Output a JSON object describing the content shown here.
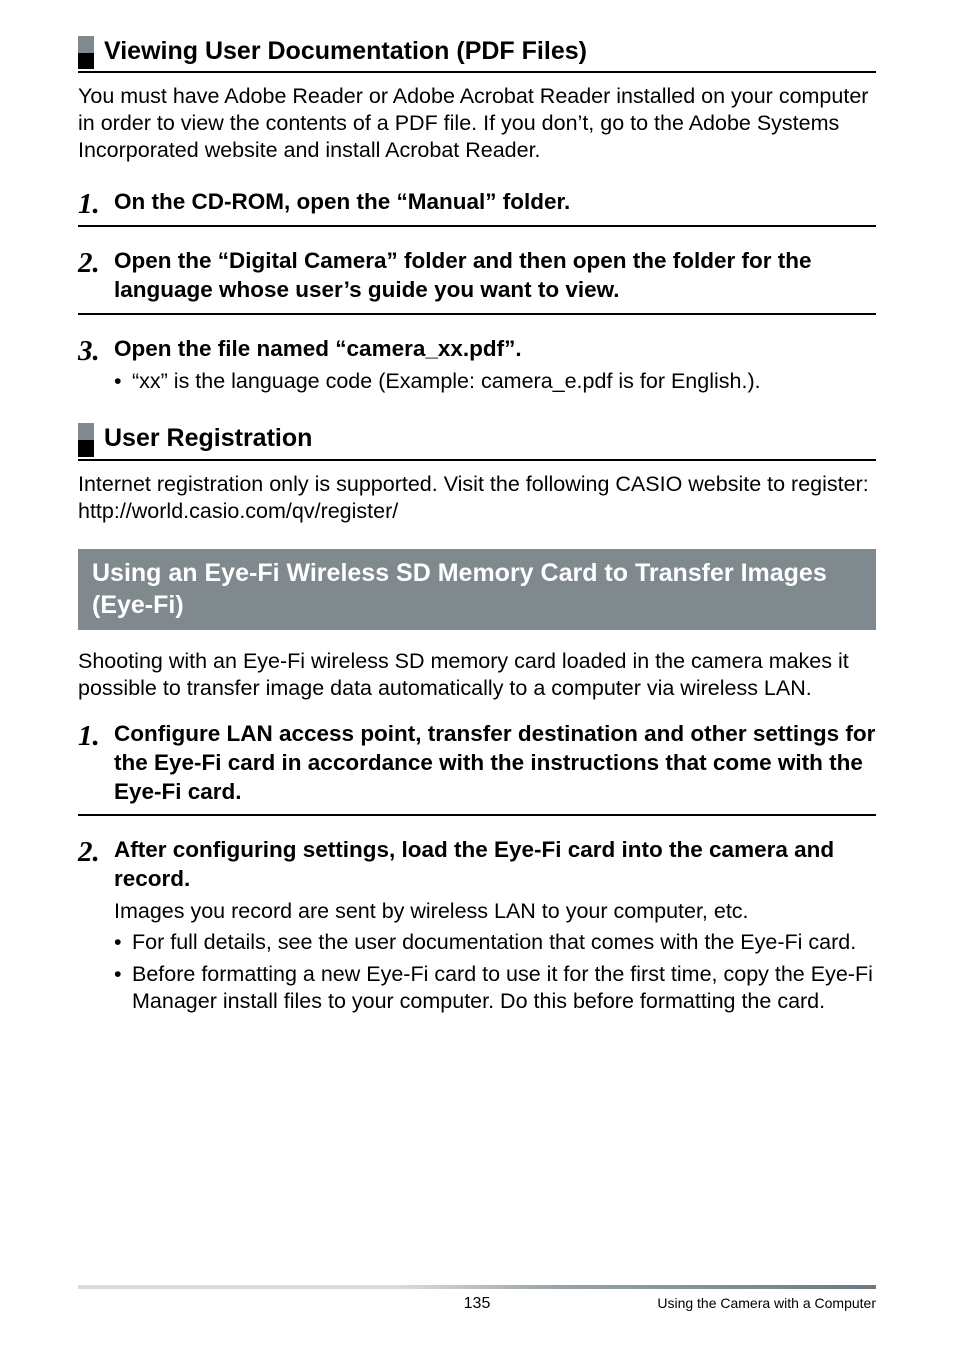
{
  "section1": {
    "title": "Viewing User Documentation (PDF Files)",
    "intro": "You must have Adobe Reader or Adobe Acrobat Reader installed on your computer in order to view the contents of a PDF file. If you don’t, go to the Adobe Systems Incorporated website and install Acrobat Reader.",
    "steps": [
      {
        "num": "1.",
        "title": "On the CD-ROM, open the “Manual” folder."
      },
      {
        "num": "2.",
        "title": "Open the “Digital Camera” folder and then open the folder for the language whose user’s guide you want to view."
      },
      {
        "num": "3.",
        "title": "Open the file named “camera_xx.pdf”.",
        "bullets": [
          "“xx” is the language code (Example: camera_e.pdf is for English.)."
        ]
      }
    ]
  },
  "section2": {
    "title": "User Registration",
    "body1": "Internet registration only is supported. Visit the following CASIO website to register:",
    "body2": "http://world.casio.com/qv/register/"
  },
  "section3": {
    "title": "Using an Eye-Fi Wireless SD Memory Card to Transfer Images (Eye-Fi)",
    "intro": "Shooting with an Eye-Fi wireless SD memory card loaded in the camera makes it possible to transfer image data automatically to a computer via wireless LAN.",
    "steps": [
      {
        "num": "1.",
        "title": "Configure LAN access point, transfer destination and other settings for the Eye-Fi card in accordance with the instructions that come with the Eye-Fi card."
      },
      {
        "num": "2.",
        "title": "After configuring settings, load the Eye-Fi card into the camera and record.",
        "detail": "Images you record are sent by wireless LAN to your computer, etc.",
        "bullets": [
          "For full details, see the user documentation that comes with the Eye-Fi card.",
          "Before formatting a new Eye-Fi card to use it for the first time, copy the Eye-Fi Manager install files to your computer. Do this before formatting the card."
        ]
      }
    ]
  },
  "footer": {
    "page": "135",
    "chapter": "Using the Camera with a Computer"
  }
}
